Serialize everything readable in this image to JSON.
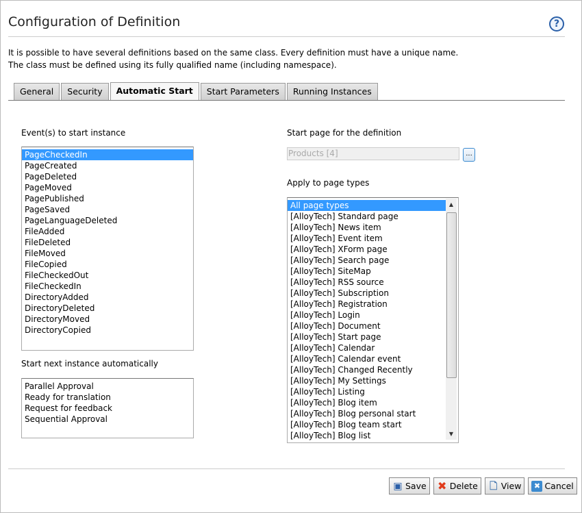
{
  "title": "Configuration of Definition",
  "intro": [
    "It is possible to have several definitions based on the same class. Every definition must have a unique name.",
    "The class must be defined using its fully qualified name (including namespace)."
  ],
  "tabs": [
    {
      "label": "General"
    },
    {
      "label": "Security"
    },
    {
      "label": "Automatic Start",
      "active": true
    },
    {
      "label": "Start Parameters"
    },
    {
      "label": "Running Instances"
    }
  ],
  "events": {
    "label": "Event(s) to start instance",
    "items": [
      "PageCheckedIn",
      "PageCreated",
      "PageDeleted",
      "PageMoved",
      "PagePublished",
      "PageSaved",
      "PageLanguageDeleted",
      "FileAdded",
      "FileDeleted",
      "FileMoved",
      "FileCopied",
      "FileCheckedOut",
      "FileCheckedIn",
      "DirectoryAdded",
      "DirectoryDeleted",
      "DirectoryMoved",
      "DirectoryCopied"
    ],
    "selected": "PageCheckedIn"
  },
  "next": {
    "label": "Start next instance automatically",
    "items": [
      "Parallel Approval",
      "Ready for translation",
      "Request for feedback",
      "Sequential Approval"
    ]
  },
  "start_page": {
    "label": "Start page for the definition",
    "value": "Products [4]",
    "browse": "..."
  },
  "page_types": {
    "label": "Apply to page types",
    "items": [
      "All page types",
      "[AlloyTech] Standard page",
      "[AlloyTech] News item",
      "[AlloyTech] Event item",
      "[AlloyTech] XForm page",
      "[AlloyTech] Search page",
      "[AlloyTech] SiteMap",
      "[AlloyTech] RSS source",
      "[AlloyTech] Subscription",
      "[AlloyTech] Registration",
      "[AlloyTech] Login",
      "[AlloyTech] Document",
      "[AlloyTech] Start page",
      "[AlloyTech] Calendar",
      "[AlloyTech] Calendar event",
      "[AlloyTech] Changed Recently",
      "[AlloyTech] My Settings",
      "[AlloyTech] Listing",
      "[AlloyTech] Blog item",
      "[AlloyTech] Blog personal start",
      "[AlloyTech] Blog team start",
      "[AlloyTech] Blog list"
    ],
    "selected": "All page types"
  },
  "buttons": {
    "save": "Save",
    "delete": "Delete",
    "view": "View",
    "cancel": "Cancel"
  },
  "icons": {
    "help": "question-icon",
    "save": "floppy-icon",
    "delete": "red-x-icon",
    "view": "magnifier-page-icon",
    "cancel": "blue-x-icon"
  }
}
